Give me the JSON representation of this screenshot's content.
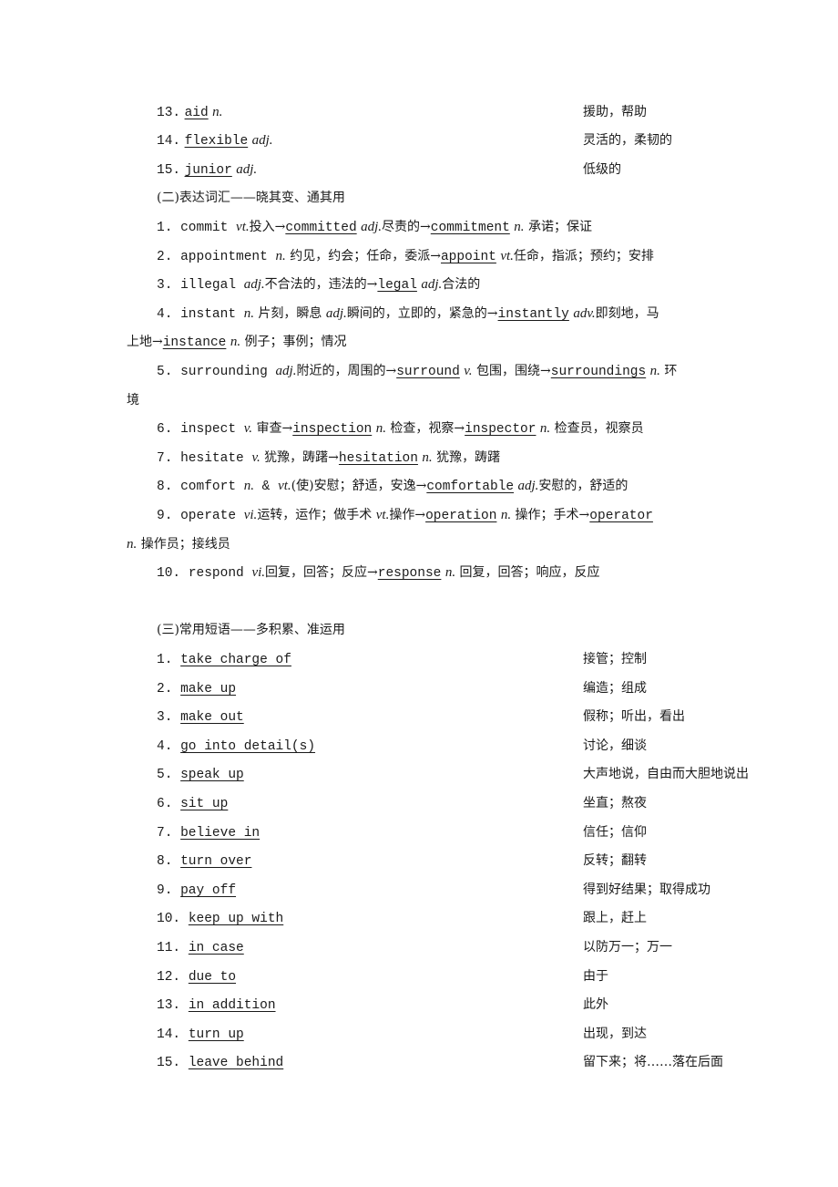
{
  "vocab_tail": [
    {
      "num": "13.",
      "word": "aid",
      "pos": "n.",
      "meaning": "援助，帮助"
    },
    {
      "num": "14.",
      "word": "flexible",
      "pos": "adj.",
      "meaning": "灵活的，柔韧的"
    },
    {
      "num": "15.",
      "word": "junior",
      "pos": "adj.",
      "meaning": "低级的"
    }
  ],
  "section2": {
    "title": "(二)表达词汇——晓其变、通其用",
    "items": [
      {
        "num": "1.",
        "parts": [
          {
            "t": "commit ",
            "s": "mono"
          },
          {
            "t": "vt.",
            "s": "it"
          },
          {
            "t": "投入→",
            "s": ""
          },
          {
            "t": "committed",
            "s": "mono u"
          },
          {
            "t": " ",
            "s": ""
          },
          {
            "t": "adj.",
            "s": "it"
          },
          {
            "t": "尽责的→",
            "s": ""
          },
          {
            "t": "commitment",
            "s": "mono u"
          },
          {
            "t": " ",
            "s": ""
          },
          {
            "t": "n.",
            "s": "it"
          },
          {
            "t": " 承诺；保证",
            "s": ""
          }
        ]
      },
      {
        "num": "2.",
        "parts": [
          {
            "t": "appointment ",
            "s": "mono"
          },
          {
            "t": "n.",
            "s": "it"
          },
          {
            "t": " 约见，约会；任命，委派→",
            "s": ""
          },
          {
            "t": "appoint",
            "s": "mono u"
          },
          {
            "t": " ",
            "s": ""
          },
          {
            "t": "vt.",
            "s": "it"
          },
          {
            "t": "任命，指派；预约；安排",
            "s": ""
          }
        ]
      },
      {
        "num": "3.",
        "parts": [
          {
            "t": "illegal ",
            "s": "mono"
          },
          {
            "t": "adj.",
            "s": "it"
          },
          {
            "t": "不合法的，违法的→",
            "s": ""
          },
          {
            "t": "legal",
            "s": "mono u"
          },
          {
            "t": " ",
            "s": ""
          },
          {
            "t": "adj.",
            "s": "it"
          },
          {
            "t": "合法的",
            "s": ""
          }
        ]
      },
      {
        "num": "4.",
        "parts": [
          {
            "t": "instant ",
            "s": "mono"
          },
          {
            "t": "n.",
            "s": "it"
          },
          {
            "t": " 片刻，瞬息 ",
            "s": ""
          },
          {
            "t": "adj.",
            "s": "it"
          },
          {
            "t": "瞬间的，立即的，紧急的→",
            "s": ""
          },
          {
            "t": "instantly",
            "s": "mono u"
          },
          {
            "t": " ",
            "s": ""
          },
          {
            "t": "adv.",
            "s": "it"
          },
          {
            "t": "即刻地，马",
            "s": ""
          }
        ],
        "continuation": [
          {
            "t": "上地→",
            "s": ""
          },
          {
            "t": "instance",
            "s": "mono u"
          },
          {
            "t": " ",
            "s": ""
          },
          {
            "t": "n.",
            "s": "it"
          },
          {
            "t": " 例子；事例；情况",
            "s": ""
          }
        ]
      },
      {
        "num": "5.",
        "parts": [
          {
            "t": "surrounding ",
            "s": "mono"
          },
          {
            "t": "adj.",
            "s": "it"
          },
          {
            "t": "附近的，周围的→",
            "s": ""
          },
          {
            "t": "surround",
            "s": "mono u"
          },
          {
            "t": " ",
            "s": ""
          },
          {
            "t": "v.",
            "s": "it"
          },
          {
            "t": " 包围，围绕→",
            "s": ""
          },
          {
            "t": "surroundings",
            "s": "mono u"
          },
          {
            "t": " ",
            "s": ""
          },
          {
            "t": "n.",
            "s": "it"
          },
          {
            "t": " 环",
            "s": ""
          }
        ],
        "continuation": [
          {
            "t": "境",
            "s": ""
          }
        ]
      },
      {
        "num": "6.",
        "parts": [
          {
            "t": "inspect ",
            "s": "mono"
          },
          {
            "t": "v.",
            "s": "it"
          },
          {
            "t": " 审查→",
            "s": ""
          },
          {
            "t": "inspection",
            "s": "mono u"
          },
          {
            "t": " ",
            "s": ""
          },
          {
            "t": "n.",
            "s": "it"
          },
          {
            "t": " 检查，视察→",
            "s": ""
          },
          {
            "t": "inspector",
            "s": "mono u"
          },
          {
            "t": " ",
            "s": ""
          },
          {
            "t": "n.",
            "s": "it"
          },
          {
            "t": " 检查员，视察员",
            "s": ""
          }
        ]
      },
      {
        "num": "7.",
        "parts": [
          {
            "t": "hesitate ",
            "s": "mono"
          },
          {
            "t": "v.",
            "s": "it"
          },
          {
            "t": " 犹豫，踌躇→",
            "s": ""
          },
          {
            "t": "hesitation",
            "s": "mono u"
          },
          {
            "t": " ",
            "s": ""
          },
          {
            "t": "n.",
            "s": "it"
          },
          {
            "t": " 犹豫，踌躇",
            "s": ""
          }
        ]
      },
      {
        "num": "8.",
        "parts": [
          {
            "t": "comfort ",
            "s": "mono"
          },
          {
            "t": "n.",
            "s": "it"
          },
          {
            "t": " & ",
            "s": "mono"
          },
          {
            "t": "vt.",
            "s": "it"
          },
          {
            "t": "(使)安慰；舒适，安逸→",
            "s": ""
          },
          {
            "t": "comfortable",
            "s": "mono u"
          },
          {
            "t": " ",
            "s": ""
          },
          {
            "t": "adj.",
            "s": "it"
          },
          {
            "t": "安慰的，舒适的",
            "s": ""
          }
        ]
      },
      {
        "num": "9.",
        "parts": [
          {
            "t": "operate ",
            "s": "mono"
          },
          {
            "t": "vi.",
            "s": "it"
          },
          {
            "t": "运转，运作；做手术 ",
            "s": ""
          },
          {
            "t": "vt.",
            "s": "it"
          },
          {
            "t": "操作→",
            "s": ""
          },
          {
            "t": "operation",
            "s": "mono u"
          },
          {
            "t": " ",
            "s": ""
          },
          {
            "t": "n.",
            "s": "it"
          },
          {
            "t": " 操作；手术→",
            "s": ""
          },
          {
            "t": "operator",
            "s": "mono u"
          }
        ],
        "continuation": [
          {
            "t": "n.",
            "s": "it"
          },
          {
            "t": " 操作员；接线员",
            "s": ""
          }
        ]
      },
      {
        "num": "10.",
        "parts": [
          {
            "t": "respond ",
            "s": "mono"
          },
          {
            "t": "vi.",
            "s": "it"
          },
          {
            "t": "回复，回答；反应→",
            "s": ""
          },
          {
            "t": "response",
            "s": "mono u"
          },
          {
            "t": " ",
            "s": ""
          },
          {
            "t": "n.",
            "s": "it"
          },
          {
            "t": " 回复，回答；响应，反应",
            "s": ""
          }
        ]
      }
    ]
  },
  "section3": {
    "title": "(三)常用短语——多积累、准运用",
    "items": [
      {
        "num": "1.",
        "phrase": "take charge of",
        "meaning": "接管；控制"
      },
      {
        "num": "2.",
        "phrase": "make up ",
        "meaning": "编造；组成"
      },
      {
        "num": "3.",
        "phrase": "make out",
        "meaning": "假称；听出，看出"
      },
      {
        "num": "4.",
        "phrase": "go into detail(s)",
        "meaning": "讨论，细谈"
      },
      {
        "num": "5.",
        "phrase": "speak up",
        "meaning": "大声地说，自由而大胆地说出"
      },
      {
        "num": "6.",
        "phrase": "sit up",
        "meaning": "坐直；熬夜"
      },
      {
        "num": "7.",
        "phrase": "believe in",
        "meaning": "信任；信仰"
      },
      {
        "num": "8.",
        "phrase": "turn over",
        "meaning": "反转；翻转"
      },
      {
        "num": "9.",
        "phrase": "pay off",
        "meaning": "得到好结果；取得成功"
      },
      {
        "num": "10.",
        "phrase": "keep up with",
        "meaning": "跟上，赶上"
      },
      {
        "num": "11.",
        "phrase": "in case",
        "meaning": "以防万一；万一"
      },
      {
        "num": "12.",
        "phrase": "due to",
        "meaning": "由于"
      },
      {
        "num": "13.",
        "phrase": "in addition",
        "meaning": "此外"
      },
      {
        "num": "14.",
        "phrase": "turn up",
        "meaning": "出现，到达"
      },
      {
        "num": "15.",
        "phrase": "leave behind",
        "meaning": "留下来；将……落在后面"
      }
    ]
  }
}
